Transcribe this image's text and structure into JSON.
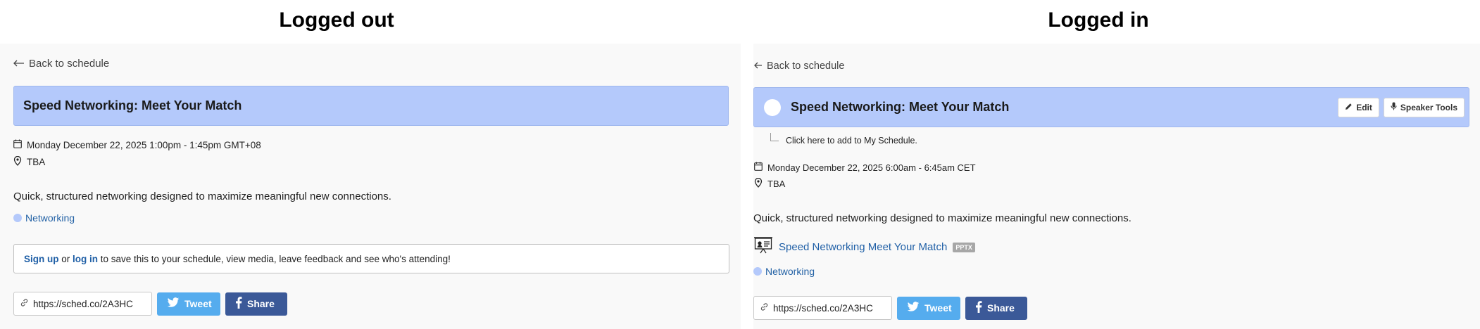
{
  "headings": {
    "left": "Logged out",
    "right": "Logged in"
  },
  "logged_out": {
    "back_link": "Back to schedule",
    "title": "Speed Networking: Meet Your Match",
    "datetime": "Monday December 22, 2025 1:00pm - 1:45pm GMT+08",
    "location": "TBA",
    "description": "Quick, structured networking designed to maximize meaningful new connections.",
    "tag": "Networking",
    "notice": {
      "signup": "Sign up",
      "or": " or ",
      "login": "log in",
      "rest": " to save this to your schedule, view media, leave feedback and see who's attending!"
    },
    "share": {
      "url": "https://sched.co/2A3HC",
      "tweet": "Tweet",
      "facebook": "Share"
    }
  },
  "logged_in": {
    "back_link": "Back to schedule",
    "title": "Speed Networking: Meet Your Match",
    "edit_label": "Edit",
    "speaker_tools_label": "Speaker Tools",
    "add_hint": "Click here to add to My Schedule.",
    "datetime": "Monday December 22, 2025 6:00am - 6:45am CET",
    "location": "TBA",
    "description": "Quick, structured networking designed to maximize meaningful new connections.",
    "file": {
      "name": "Speed Networking Meet Your Match",
      "type": "PPTX"
    },
    "tag": "Networking",
    "share": {
      "url": "https://sched.co/2A3HC",
      "tweet": "Tweet",
      "facebook": "Share"
    }
  },
  "colors": {
    "title_bar": "#b4c9fb",
    "link": "#1f5fa6",
    "tweet": "#55acee",
    "facebook": "#3b5998"
  },
  "icons": [
    "arrow-left-icon",
    "calendar-icon",
    "location-pin-icon",
    "link-icon",
    "twitter-icon",
    "facebook-icon",
    "pencil-icon",
    "microphone-icon",
    "presentation-icon"
  ]
}
